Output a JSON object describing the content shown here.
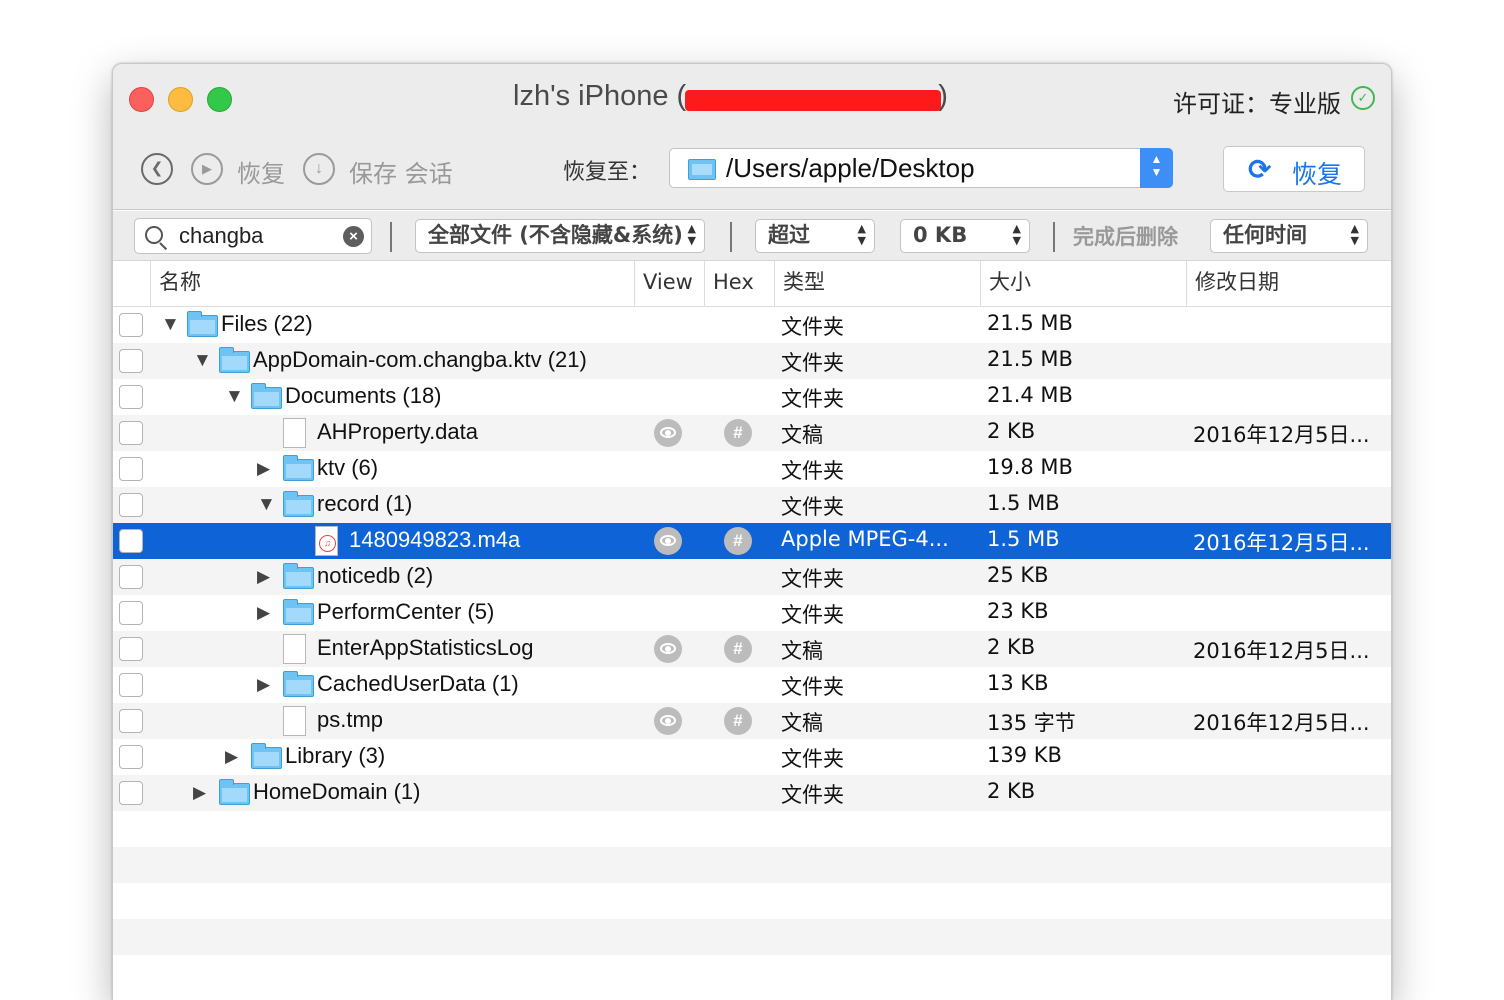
{
  "window": {
    "title": "lzh's iPhone (",
    "title_end": ")",
    "license": "许可证：专业版"
  },
  "toolbar": {
    "back_icon": "chevron-left-icon",
    "play_icon": "play-icon",
    "restore_label": "恢复",
    "save_icon": "download-icon",
    "save_session_label": "保存 会话",
    "restore_to_label": "恢复至：",
    "path": "/Users/apple/Desktop",
    "restore_button": "恢复"
  },
  "filters": {
    "search_value": "changba",
    "file_scope": "全部文件 (不含隐藏&系统)",
    "size_op": "超过",
    "size_value": "0 KB",
    "delete_after": "完成后删除",
    "time": "任何时间"
  },
  "columns": {
    "name": "名称",
    "view": "View",
    "hex": "Hex",
    "type": "类型",
    "size": "大小",
    "modified": "修改日期"
  },
  "rows": [
    {
      "indent": 0,
      "expander": "down",
      "kind": "folder",
      "name": "Files (22)",
      "type": "文件夹",
      "size": "21.5 MB",
      "date": ""
    },
    {
      "indent": 1,
      "expander": "down",
      "kind": "folder",
      "name": "AppDomain-com.changba.ktv (21)",
      "type": "文件夹",
      "size": "21.5 MB",
      "date": ""
    },
    {
      "indent": 2,
      "expander": "down",
      "kind": "folder",
      "name": "Documents (18)",
      "type": "文件夹",
      "size": "21.4 MB",
      "date": ""
    },
    {
      "indent": 3,
      "expander": "none",
      "kind": "doc",
      "name": "AHProperty.data",
      "type": "文稿",
      "size": "2 KB",
      "date": "2016年12月5日..."
    },
    {
      "indent": 3,
      "expander": "right",
      "kind": "folder",
      "name": "ktv (6)",
      "type": "文件夹",
      "size": "19.8 MB",
      "date": ""
    },
    {
      "indent": 3,
      "expander": "down",
      "kind": "folder",
      "name": "record (1)",
      "type": "文件夹",
      "size": "1.5 MB",
      "date": ""
    },
    {
      "indent": 4,
      "expander": "none",
      "kind": "audio",
      "name": "1480949823.m4a",
      "type": "Apple MPEG-4...",
      "size": "1.5 MB",
      "date": "2016年12月5日...",
      "selected": true
    },
    {
      "indent": 3,
      "expander": "right",
      "kind": "folder",
      "name": "noticedb (2)",
      "type": "文件夹",
      "size": "25 KB",
      "date": ""
    },
    {
      "indent": 3,
      "expander": "right",
      "kind": "folder",
      "name": "PerformCenter (5)",
      "type": "文件夹",
      "size": "23 KB",
      "date": ""
    },
    {
      "indent": 3,
      "expander": "none",
      "kind": "doc",
      "name": "EnterAppStatisticsLog",
      "type": "文稿",
      "size": "2 KB",
      "date": "2016年12月5日..."
    },
    {
      "indent": 3,
      "expander": "right",
      "kind": "folder",
      "name": "CachedUserData (1)",
      "type": "文件夹",
      "size": "13 KB",
      "date": ""
    },
    {
      "indent": 3,
      "expander": "none",
      "kind": "doc",
      "name": "ps.tmp",
      "type": "文稿",
      "size": "135 字节",
      "date": "2016年12月5日..."
    },
    {
      "indent": 2,
      "expander": "right",
      "kind": "folder",
      "name": "Library (3)",
      "type": "文件夹",
      "size": "139 KB",
      "date": ""
    },
    {
      "indent": 1,
      "expander": "right",
      "kind": "folder",
      "name": "HomeDomain (1)",
      "type": "文件夹",
      "size": "2 KB",
      "date": ""
    }
  ],
  "colors": {
    "selection": "#0e63d6",
    "accent": "#1b74e8",
    "folder": "#6fc3f3",
    "license_check": "#43b84e"
  }
}
